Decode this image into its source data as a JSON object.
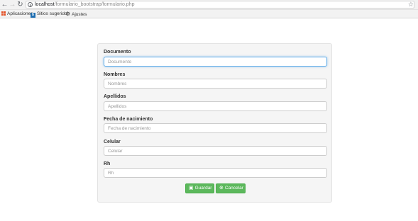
{
  "browser": {
    "url_host": "localhost",
    "url_path": "/formulario_bootstrap/formulario.php",
    "bookmarks": {
      "apps": "Aplicaciones",
      "suggested_sites": "Sitios sugeridos",
      "settings": "Ajustes"
    }
  },
  "form": {
    "fields": [
      {
        "label": "Documento",
        "placeholder": "Documento",
        "value": ""
      },
      {
        "label": "Nombres",
        "placeholder": "Nombres",
        "value": ""
      },
      {
        "label": "Apellidos",
        "placeholder": "Apellidos",
        "value": ""
      },
      {
        "label": "Fecha de nacimiento",
        "placeholder": "Fecha de nacimiento",
        "value": ""
      },
      {
        "label": "Celular",
        "placeholder": "Celular",
        "value": ""
      },
      {
        "label": "Rh",
        "placeholder": "Rh",
        "value": ""
      }
    ],
    "save_label": "Guardar",
    "cancel_label": "Cancelar"
  },
  "icons": {
    "back": "arrow-left-icon",
    "forward": "arrow-right-icon",
    "reload": "reload-icon",
    "info": "info-icon",
    "bookmark_star": "star-icon",
    "apps": "apps-grid-icon",
    "suggested_sites": "sites-icon",
    "settings": "gear-icon",
    "save": "floppy-disk-icon",
    "cancel": "circle-x-icon"
  },
  "colors": {
    "button_success": "#5cb85c",
    "focus_border": "#66afe9",
    "panel_background": "#f5f5f5"
  }
}
